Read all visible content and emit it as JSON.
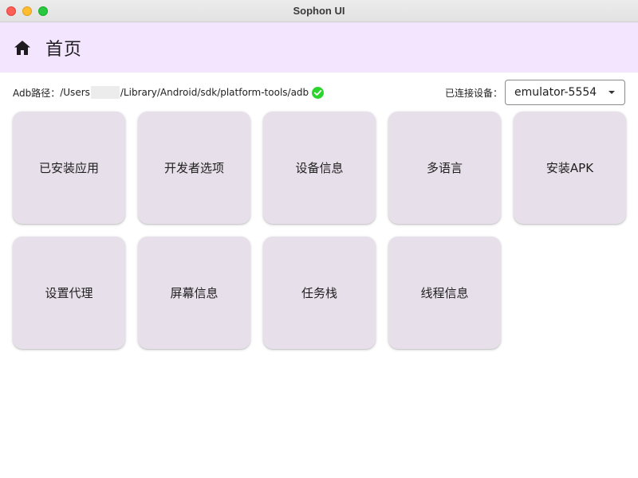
{
  "window": {
    "title": "Sophon UI"
  },
  "appbar": {
    "icon": "home-icon",
    "title": "首页"
  },
  "adb": {
    "label": "Adb路径：",
    "path_prefix": "/Users",
    "path_suffix": "/Library/Android/sdk/platform-tools/adb",
    "status_icon": "check-circle-icon",
    "status_color": "#2bd52b"
  },
  "device": {
    "label": "已连接设备：",
    "selected": "emulator-5554"
  },
  "tiles": [
    {
      "label": "已安装应用"
    },
    {
      "label": "开发者选项"
    },
    {
      "label": "设备信息"
    },
    {
      "label": "多语言"
    },
    {
      "label": "安装APK"
    },
    {
      "label": "设置代理"
    },
    {
      "label": "屏幕信息"
    },
    {
      "label": "任务栈"
    },
    {
      "label": "线程信息"
    }
  ],
  "colors": {
    "appbar_bg": "#f3e5fd",
    "tile_bg": "#e7dfea"
  }
}
